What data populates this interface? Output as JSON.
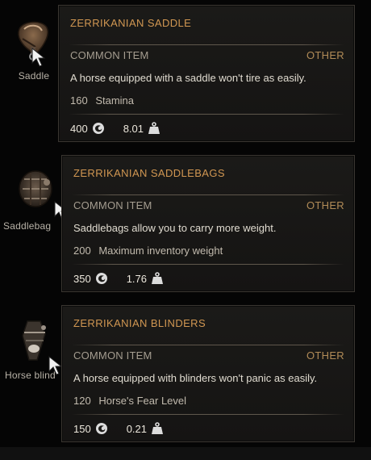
{
  "colors": {
    "title": "#d19752",
    "category": "#b18b57",
    "background": "#050505",
    "panel": "#1b1a18",
    "border": "#3a3631"
  },
  "items": [
    {
      "slot_label": "Saddle",
      "icon": "saddle-icon",
      "title": "ZERRIKANIAN SADDLE",
      "rarity": "COMMON ITEM",
      "category": "OTHER",
      "description": "A horse equipped with a saddle won't tire as easily.",
      "stat_value": "160",
      "stat_label": "Stamina",
      "price": "400",
      "weight": "8.01"
    },
    {
      "slot_label": "Saddlebag",
      "icon": "saddlebags-icon",
      "title": "ZERRIKANIAN SADDLEBAGS",
      "rarity": "COMMON ITEM",
      "category": "OTHER",
      "description": "Saddlebags allow you to carry more weight.",
      "stat_value": "200",
      "stat_label": "Maximum inventory weight",
      "price": "350",
      "weight": "1.76"
    },
    {
      "slot_label": "Horse blind",
      "icon": "blinders-icon",
      "title": "ZERRIKANIAN BLINDERS",
      "rarity": "COMMON ITEM",
      "category": "OTHER",
      "description": "A horse equipped with blinders won't panic as easily.",
      "stat_value": "120",
      "stat_label": "Horse's Fear Level",
      "price": "150",
      "weight": "0.21"
    }
  ]
}
